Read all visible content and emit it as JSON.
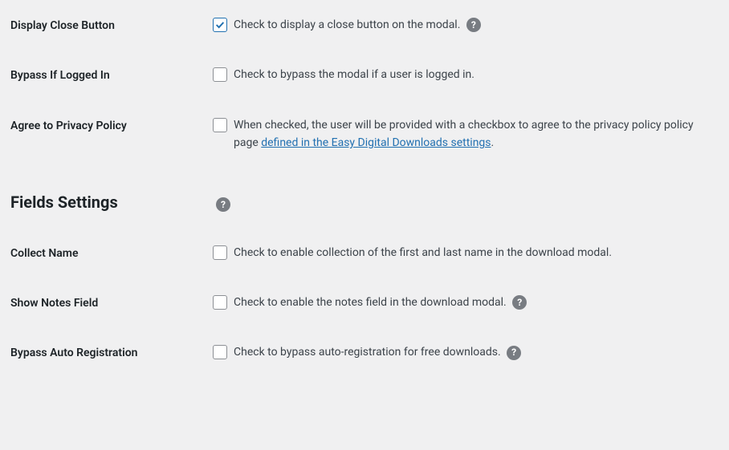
{
  "rows": {
    "display_close": {
      "label": "Display Close Button",
      "desc": "Check to display a close button on the modal.",
      "checked": true,
      "help": true
    },
    "bypass_logged_in": {
      "label": "Bypass If Logged In",
      "desc": "Check to bypass the modal if a user is logged in.",
      "checked": false,
      "help": false
    },
    "privacy_policy": {
      "label": "Agree to Privacy Policy",
      "desc_pre": "When checked, the user will be provided with a checkbox to agree to the privacy policy policy page ",
      "link_text": "defined in the Easy Digital Downloads settings",
      "desc_post": ".",
      "checked": false,
      "help": false
    },
    "collect_name": {
      "label": "Collect Name",
      "desc": "Check to enable collection of the first and last name in the download modal.",
      "checked": false,
      "help": false
    },
    "show_notes": {
      "label": "Show Notes Field",
      "desc": "Check to enable the notes field in the download modal.",
      "checked": false,
      "help": true
    },
    "bypass_auto_reg": {
      "label": "Bypass Auto Registration",
      "desc": "Check to bypass auto-registration for free downloads.",
      "checked": false,
      "help": true
    }
  },
  "section": {
    "fields_heading": "Fields Settings"
  }
}
